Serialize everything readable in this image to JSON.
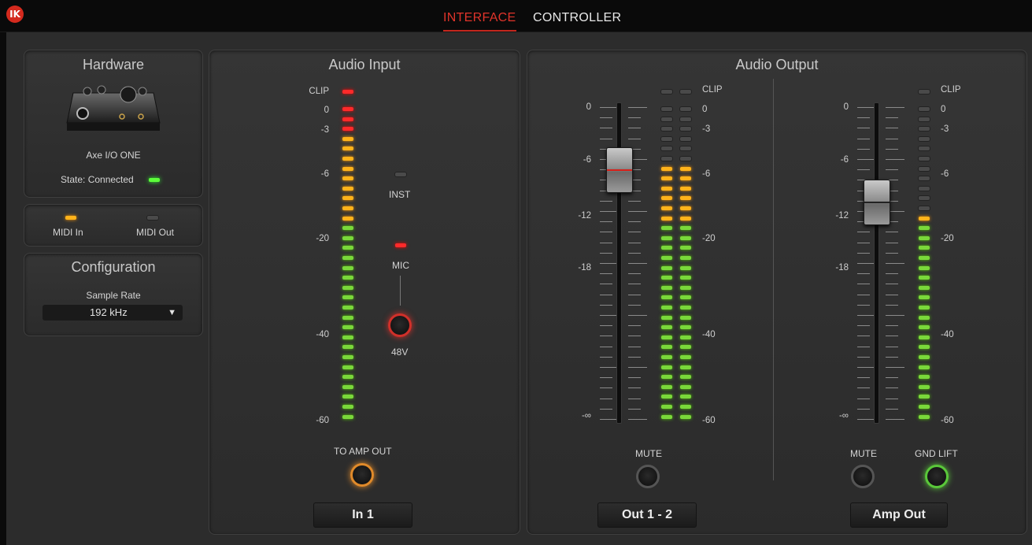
{
  "tabs": [
    {
      "label": "INTERFACE",
      "active": true
    },
    {
      "label": "CONTROLLER",
      "active": false
    }
  ],
  "logo": {
    "icon": "ik-logo-icon",
    "color": "#d42a1e"
  },
  "hardware": {
    "title": "Hardware",
    "device_name": "Axe I/O ONE",
    "state_label": "State: Connected",
    "state_led": "green"
  },
  "midi": {
    "in_label": "MIDI In",
    "in_led": "orange",
    "out_label": "MIDI Out",
    "out_led": "off"
  },
  "configuration": {
    "title": "Configuration",
    "sample_rate_label": "Sample Rate",
    "sample_rate_value": "192 kHz"
  },
  "audio_input": {
    "title": "Audio Input",
    "scale": [
      "CLIP",
      "0",
      "-3",
      "-6",
      "-20",
      "-40",
      "-60"
    ],
    "inst_label": "INST",
    "inst_led": "off",
    "mic_label": "MIC",
    "mic_led": "red",
    "phantom_label": "48V",
    "to_amp_label": "TO AMP OUT",
    "channel_name": "In 1"
  },
  "audio_output": {
    "title": "Audio Output",
    "out12": {
      "fader_scale": [
        "0",
        "-6",
        "-12",
        "-18",
        "-∞"
      ],
      "meter_scale": [
        "CLIP",
        "0",
        "-3",
        "-6",
        "-20",
        "-40",
        "-60"
      ],
      "mute_label": "MUTE",
      "channel_name": "Out 1 - 2"
    },
    "amp": {
      "fader_scale": [
        "0",
        "-6",
        "-12",
        "-18",
        "-∞"
      ],
      "meter_scale": [
        "CLIP",
        "0",
        "-3",
        "-6",
        "-20",
        "-40",
        "-60"
      ],
      "mute_label": "MUTE",
      "gnd_lift_label": "GND LIFT",
      "channel_name": "Amp Out"
    }
  },
  "colors": {
    "accent": "#e0342a",
    "led_green": "#7ad83a",
    "led_orange": "#ffb31a",
    "led_red": "#ff2a2a"
  }
}
